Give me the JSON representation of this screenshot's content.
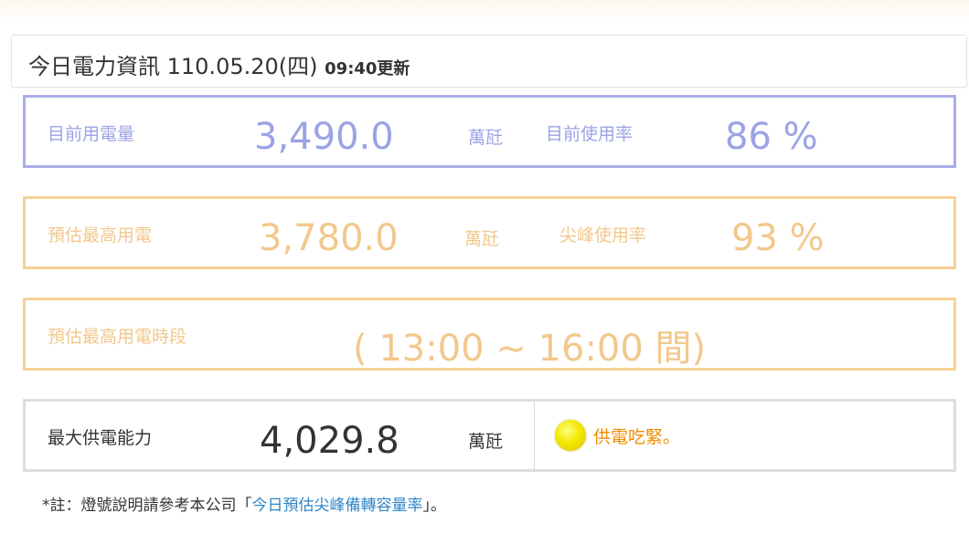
{
  "header": {
    "title": "今日電力資訊 110.05.20(四)",
    "update_time": "09:40更新"
  },
  "current": {
    "usage_label": "目前用電量",
    "usage_value": "3,490.0",
    "usage_unit": "萬瓩",
    "rate_label": "目前使用率",
    "rate_value": "86 %"
  },
  "peak": {
    "usage_label": "預估最高用電",
    "usage_value": "3,780.0",
    "usage_unit": "萬瓩",
    "rate_label": "尖峰使用率",
    "rate_value": "93 %"
  },
  "period": {
    "label": "預估最高用電時段",
    "value": "( 13:00 ~ 16:00 間)"
  },
  "supply": {
    "label": "最大供電能力",
    "value": "4,029.8",
    "unit": "萬瓩",
    "light_color": "#f3e800",
    "status_text": "供電吃緊。"
  },
  "note": {
    "prefix": "*註：燈號說明請參考本公司「",
    "link_text": "今日預估尖峰備轉容量率",
    "suffix": "」。"
  },
  "colors": {
    "current_accent": "#9ba3e6",
    "peak_accent": "#f2c88c",
    "status_orange": "#f28c00",
    "link_blue": "#2f86c7"
  }
}
